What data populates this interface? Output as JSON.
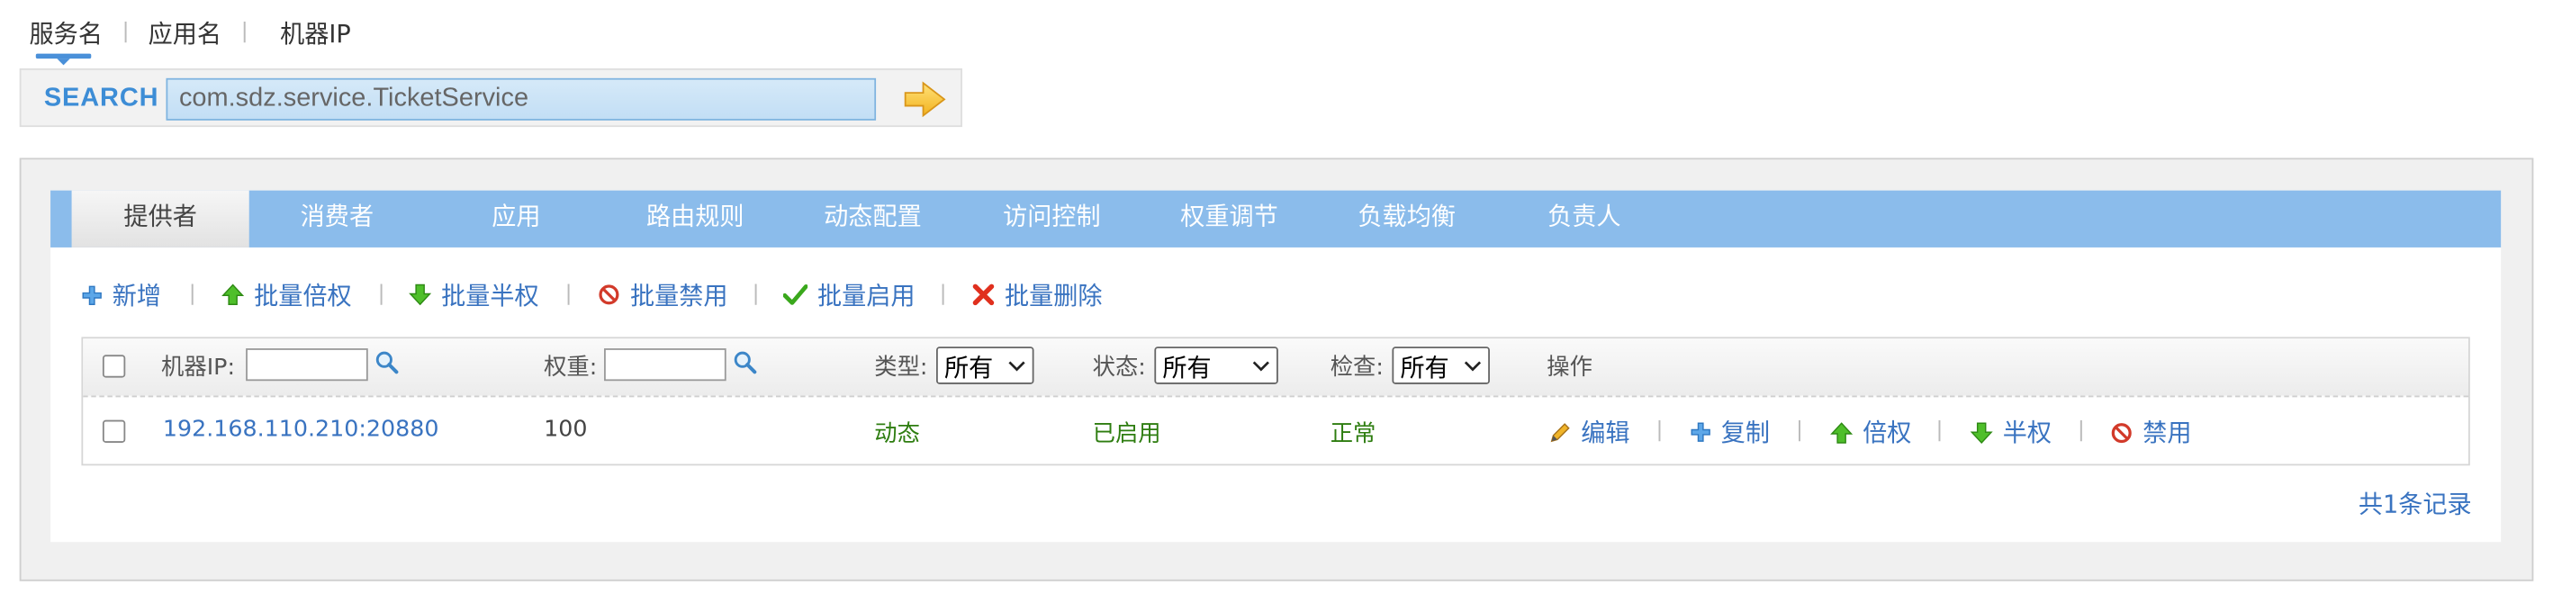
{
  "search_types": [
    {
      "label": "服务名",
      "active": true
    },
    {
      "label": "应用名",
      "active": false
    },
    {
      "label": "机器IP",
      "active": false
    }
  ],
  "search": {
    "label": "SEARCH",
    "value": "com.sdz.service.TicketService",
    "go_icon": "arrow-right-icon"
  },
  "tabs": [
    {
      "label": "提供者",
      "active": true
    },
    {
      "label": "消费者"
    },
    {
      "label": "应用"
    },
    {
      "label": "路由规则"
    },
    {
      "label": "动态配置"
    },
    {
      "label": "访问控制"
    },
    {
      "label": "权重调节"
    },
    {
      "label": "负载均衡"
    },
    {
      "label": "负责人"
    }
  ],
  "actions": [
    {
      "label": "新增",
      "icon": "plus-icon"
    },
    {
      "label": "批量倍权",
      "icon": "arrow-up-icon"
    },
    {
      "label": "批量半权",
      "icon": "arrow-down-icon"
    },
    {
      "label": "批量禁用",
      "icon": "disable-icon"
    },
    {
      "label": "批量启用",
      "icon": "check-icon"
    },
    {
      "label": "批量删除",
      "icon": "delete-icon"
    }
  ],
  "table": {
    "headers": {
      "ip": "机器IP:",
      "weight": "权重:",
      "type": "类型:",
      "status": "状态:",
      "check": "检查:",
      "ops": "操作"
    },
    "filters": {
      "type_selected": "所有",
      "status_selected": "所有",
      "check_selected": "所有"
    },
    "rows": [
      {
        "address": "192.168.110.210:20880",
        "weight": "100",
        "type": "动态",
        "status": "已启用",
        "check": "正常",
        "ops": [
          {
            "label": "编辑",
            "icon": "pencil-icon"
          },
          {
            "label": "复制",
            "icon": "copy-icon"
          },
          {
            "label": "倍权",
            "icon": "arrow-up-icon"
          },
          {
            "label": "半权",
            "icon": "arrow-down-icon"
          },
          {
            "label": "禁用",
            "icon": "disable-icon"
          }
        ]
      }
    ]
  },
  "footer": {
    "total": "共1条记录"
  },
  "colors": {
    "tabbar": "#8bbceb",
    "link": "#3973c0",
    "ok_green": "#2e7d10",
    "search_label": "#3d8dd6"
  }
}
